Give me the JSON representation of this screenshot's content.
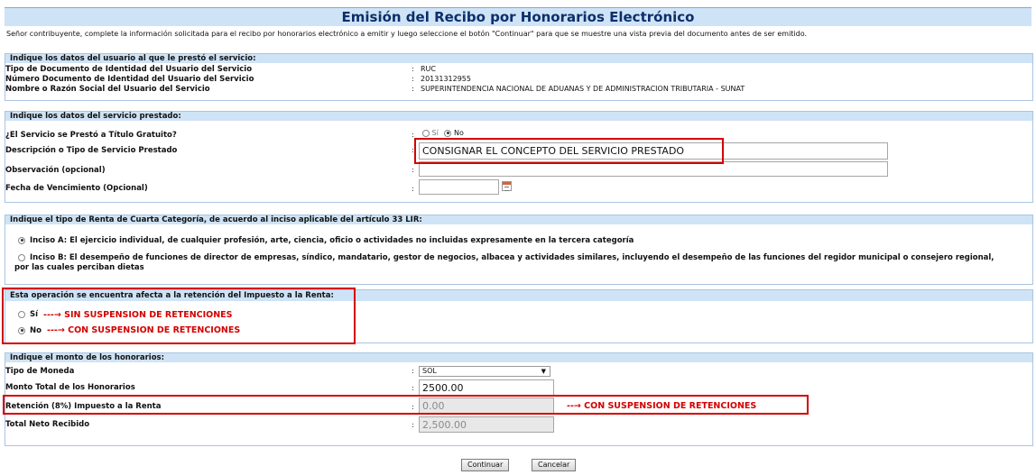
{
  "page": {
    "title": "Emisión del Recibo por Honorarios Electrónico",
    "intro": "Señor contribuyente, complete la información solicitada para el recibo por honorarios electrónico a emitir y luego seleccione el botón \"Continuar\" para que se muestre una vista previa del documento antes de ser emitido."
  },
  "usuario": {
    "header": "Indique los datos del usuario al que le prestó el servicio:",
    "rows": [
      {
        "label": "Tipo de Documento de Identidad del Usuario del Servicio",
        "value": "RUC"
      },
      {
        "label": "Número Documento de Identidad del Usuario del Servicio",
        "value": "20131312955"
      },
      {
        "label": "Nombre o Razón Social del Usuario del Servicio",
        "value": "SUPERINTENDENCIA NACIONAL DE ADUANAS Y DE ADMINISTRACION TRIBUTARIA - SUNAT"
      }
    ]
  },
  "servicio": {
    "header": "Indique los datos del servicio prestado:",
    "gratuito_label": "¿El Servicio se Prestó a Título Gratuito?",
    "gratuito_si": "Sí",
    "gratuito_no": "No",
    "descripcion_label": "Descripción o Tipo de Servicio Prestado",
    "descripcion_value": "CONSIGNAR EL CONCEPTO DEL SERVICIO PRESTADO",
    "observacion_label": "Observación (opcional)",
    "observacion_value": "",
    "fecha_label": "Fecha de Vencimiento (Opcional)",
    "fecha_value": ""
  },
  "renta": {
    "header": "Indique el tipo de Renta de Cuarta Categoría, de acuerdo al inciso aplicable del artículo 33 LIR:",
    "inciso_a": "Inciso A: El ejercicio individual, de cualquier profesión, arte, ciencia, oficio o actividades no incluidas expresamente en la tercera categoría",
    "inciso_b_line1": "Inciso B: El desempeño de funciones de director de empresas, síndico, mandatario, gestor de negocios, albacea y actividades similares, incluyendo el desempeño de las funciones del regidor municipal o consejero regional,",
    "inciso_b_line2": "por las cuales perciban dietas"
  },
  "retencion": {
    "header": "Esta operación se encuentra afecta a la retención del Impuesto a la Renta:",
    "si": "Sí",
    "si_note": "---→ SIN SUSPENSION DE RETENCIONES",
    "no": "No",
    "no_note": "---→ CON SUSPENSION DE RETENCIONES"
  },
  "monto": {
    "header": "Indique el monto de los honorarios:",
    "moneda_label": "Tipo de Moneda",
    "moneda_value": "SOL",
    "total_label": "Monto Total de los Honorarios",
    "total_value": "2500.00",
    "retencion_label": "Retención (8%) Impuesto a la Renta",
    "retencion_value": "0.00",
    "retencion_note": "--→ CON SUSPENSION DE RETENCIONES",
    "neto_label": "Total Neto Recibido",
    "neto_value": "2,500.00"
  },
  "buttons": {
    "continuar": "Continuar",
    "cancelar": "Cancelar"
  },
  "colors": {
    "header_bg": "#cfe3f6",
    "title": "#0b2f6b",
    "highlight": "#d40000"
  }
}
